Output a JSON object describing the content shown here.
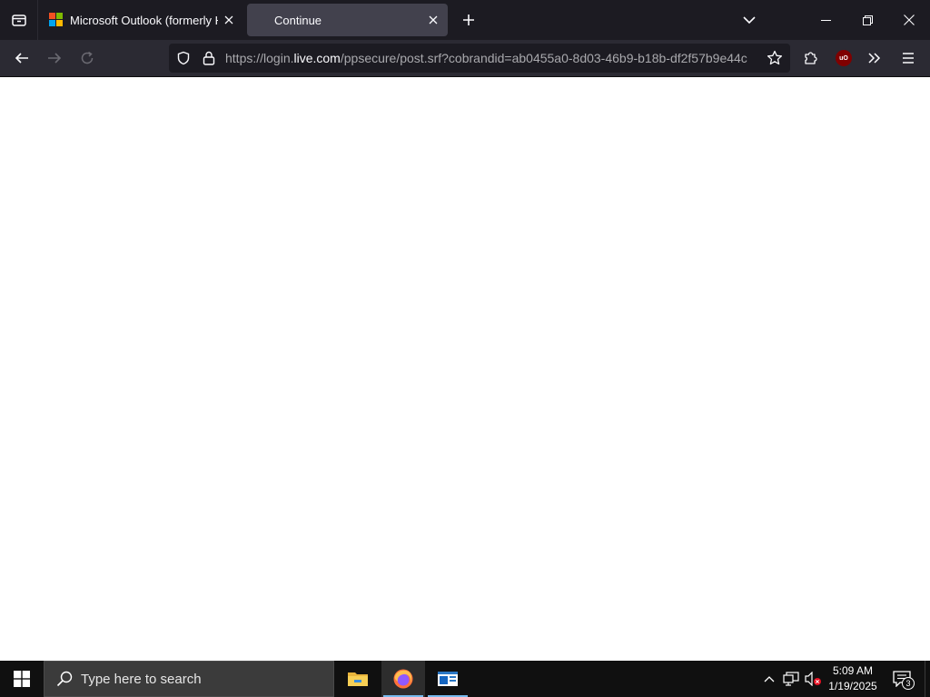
{
  "browser": {
    "tabs": [
      {
        "title": "Microsoft Outlook (formerly Hotmail)",
        "favicon": "microsoft-logo-icon",
        "active": false
      },
      {
        "title": "Continue",
        "favicon": "none",
        "active": true
      }
    ],
    "url": {
      "prefix": "https://login.",
      "domain": "live.com",
      "suffix": "/ppsecure/post.srf?cobrandid=ab0455a0-8d03-46b9-b18b-df2f57b9e44c"
    },
    "extension_badge": "uO",
    "colors": {
      "tabstrip": "#1c1b22",
      "toolbar": "#2b2a33",
      "active_tab": "#42414d",
      "urlbar": "#1c1b22"
    }
  },
  "taskbar": {
    "search_placeholder": "Type here to search",
    "apps": [
      "file-explorer-icon",
      "firefox-icon",
      "outlook-window-icon"
    ],
    "clock": {
      "time": "5:09 AM",
      "date": "1/19/2025"
    },
    "notification_count": "3"
  }
}
